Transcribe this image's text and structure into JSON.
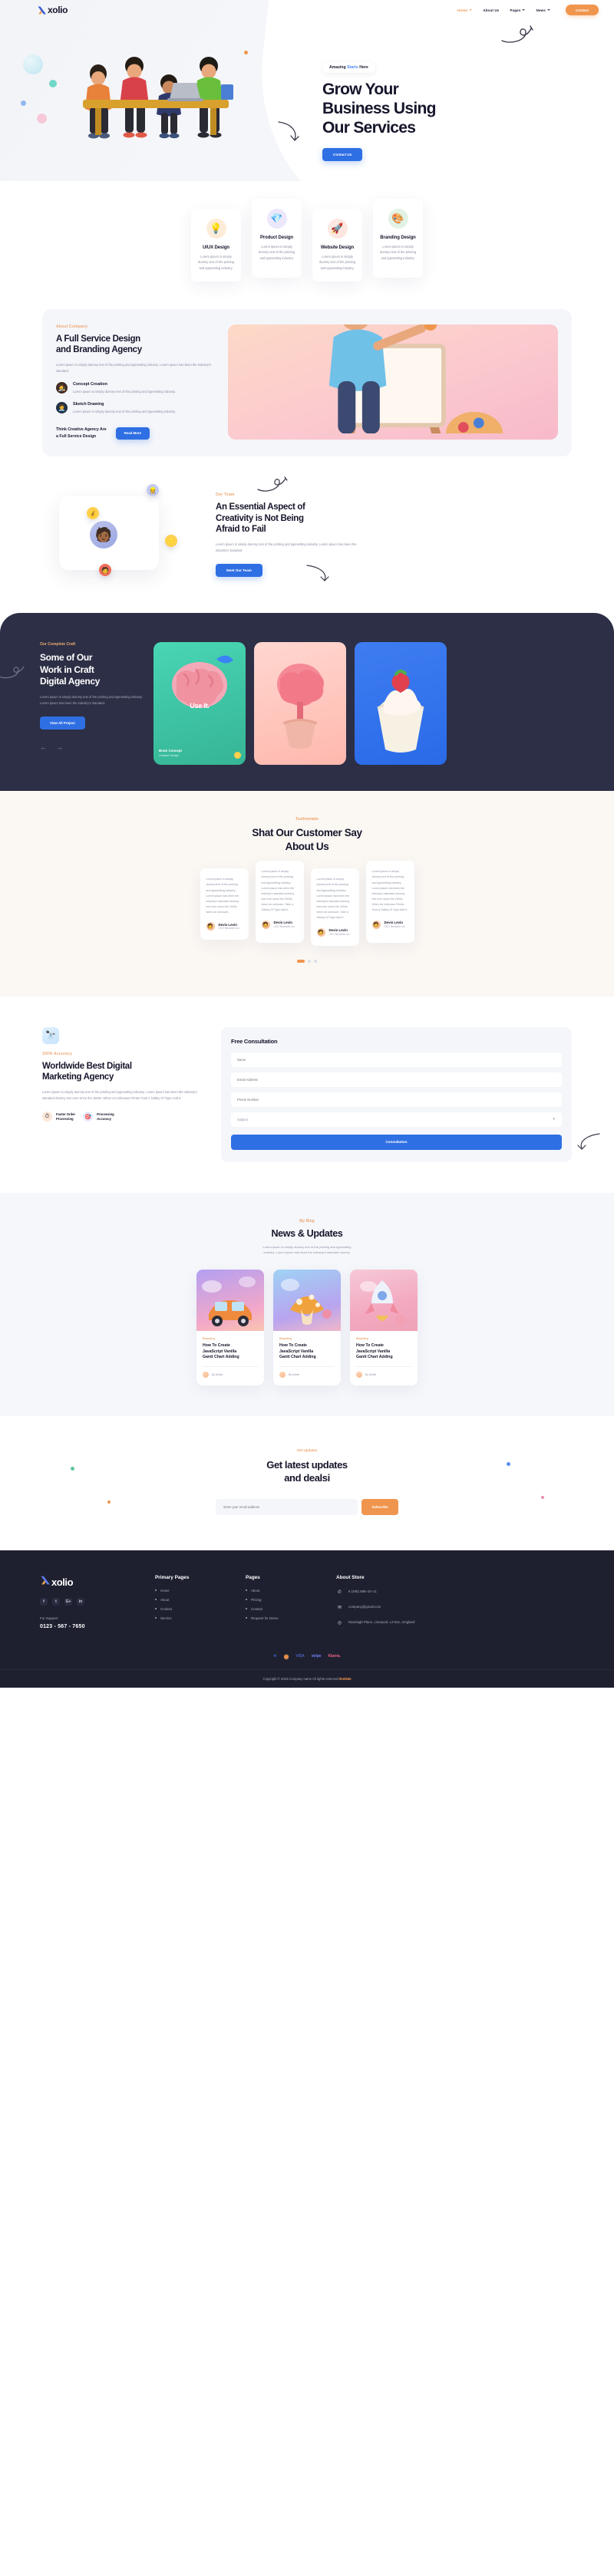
{
  "brand": {
    "name": "xolio",
    "logo_icon": "x-logo-icon"
  },
  "nav": {
    "items": [
      {
        "label": "Home",
        "caret": true,
        "active": true
      },
      {
        "label": "About Us",
        "caret": false,
        "active": false
      },
      {
        "label": "Pages",
        "caret": true,
        "active": false
      },
      {
        "label": "News",
        "caret": true,
        "active": false
      }
    ],
    "cta": "Contact"
  },
  "hero": {
    "badge_pre": "Amazing ",
    "badge_hl": "Starts",
    "badge_post": " Here",
    "title_line1": "Grow Your",
    "title_line2": "Business Using",
    "title_line3": "Our Services",
    "cta": "Contact Us"
  },
  "services": [
    {
      "title": "UIUX Design",
      "desc": "Lorem ipsum is simply dummy text of the printing and typesetting industry.",
      "icon": "lightbulb-icon",
      "icon_glyph": "💡",
      "bg": "#fdecd9"
    },
    {
      "title": "Product Design",
      "desc": "Lorem ipsum is simply dummy text of the printing and typesetting industry.",
      "icon": "gem-icon",
      "icon_glyph": "💎",
      "bg": "#ece7fb"
    },
    {
      "title": "Website Design",
      "desc": "Lorem ipsum is simply dummy text of the printing and typesetting industry.",
      "icon": "rocket-icon",
      "icon_glyph": "🚀",
      "bg": "#fde7e0"
    },
    {
      "title": "Branding Design",
      "desc": "Lorem ipsum is simply dummy text of the printing and typesetting industry.",
      "icon": "palette-icon",
      "icon_glyph": "🎨",
      "bg": "#e2f3e6"
    }
  ],
  "about": {
    "eyebrow": "About Company",
    "title_line1": "A Full Service Design",
    "title_line2": "and Branding Agency",
    "paragraph": "Lorem ipsum is simply dummy text of the printing and typesetting industry. Lorem ipsum has been the industry's standard.",
    "features": [
      {
        "title": "Concept Creation",
        "desc": "Lorem ipsum is simply dummy text of the printing and typesetting industry.",
        "icon": "concept-avatar-icon",
        "glyph": "🧑‍🎨",
        "bg": "#3f2a22"
      },
      {
        "title": "Sketch Drawing",
        "desc": "Lorem ipsum is simply dummy text of the printing and typesetting industry.",
        "icon": "sketch-avatar-icon",
        "glyph": "🧑‍💼",
        "bg": "#1f3145"
      }
    ],
    "cta_text_line1": "Think Creative Agency Are",
    "cta_text_line2": "a Full Service Design",
    "cta_button": "Read More",
    "illustration": "artist-easel-illustration"
  },
  "team": {
    "eyebrow": "Our Team",
    "title_line1": "An Essential Aspect of",
    "title_line2": "Creativity is Not Being",
    "title_line3": "Afraid to Fail",
    "paragraph": "Lorem ipsum is simply dummy text of the printing and typesetting industry. Lorem ipsum has been the industry's standard.",
    "cta": "Meet Our Team",
    "avatar_icon": "team-member-avatar",
    "badges": [
      {
        "icon": "helmet-avatar-icon",
        "glyph": "👷",
        "bg": "#c5cbee"
      },
      {
        "icon": "coin-icon",
        "glyph": "🟡",
        "bg": "#ffd04b"
      },
      {
        "icon": "star-icon",
        "glyph": "⭐",
        "bg": "#ffd04b"
      },
      {
        "icon": "person-icon",
        "glyph": "🧑",
        "bg": "#f26d5b"
      }
    ]
  },
  "portfolio": {
    "eyebrow": "Our Complete Craft",
    "title_line1": "Some of Our",
    "title_line2": "Work in Craft",
    "title_line3": "Digital Agency",
    "paragraph": "Lorem ipsum is simply dummy text of the printing and typesetting industry. Lorem ipsum has been the industry's standard.",
    "cta": "View All Project",
    "prev_icon": "arrow-left-icon",
    "next_icon": "arrow-right-icon",
    "cards": [
      {
        "overlay": "Use It.",
        "title": "Brain Concept",
        "subtitle": "Creative Design",
        "art": "brain-3d-illustration"
      },
      {
        "overlay": "",
        "title": "",
        "subtitle": "",
        "art": "coral-plant-3d-illustration"
      },
      {
        "overlay": "",
        "title": "",
        "subtitle": "",
        "art": "strawberry-cupcake-3d-illustration"
      }
    ]
  },
  "testimonials": {
    "eyebrow": "Testimonials",
    "title_line1": "Shat Our Customer Say",
    "title_line2": "About Us",
    "items": [
      {
        "quote": "Lorem ipsum is simply dummy text of the printing and typesetting industry. Lorem ipsum has been the industry's standard dummy text ever since the 1500s, when an unknown.",
        "name": "Devis Levin",
        "role": "CEO Newtoob Inc.",
        "avatar": "testimonial-avatar"
      },
      {
        "quote": "Lorem ipsum is simply dummy text of the printing and typesetting industry. Lorem ipsum has been the industry's standard dummy text ever since the 1500s, when an unknown. Take a Galaxy Of Type Add It.",
        "name": "Devis Levin",
        "role": "CEO Newtoob Inc.",
        "avatar": "testimonial-avatar"
      },
      {
        "quote": "Lorem ipsum is simply dummy text of the printing and typesetting industry. Lorem ipsum has been the industry's standard dummy text ever since the 1500s, when an unknown. Take a Galaxy Of Type Add It.",
        "name": "Devis Levin",
        "role": "CEO Newtoob Inc.",
        "avatar": "testimonial-avatar"
      },
      {
        "quote": "Lorem ipsum is simply dummy text of the printing and typesetting industry. Lorem ipsum has been the industry's standard dummy text ever since the 1500s. When An Unknown Printer Took A Galley Of Type Add It.",
        "name": "Devis Levin",
        "role": "CEO Newtoob Inc.",
        "avatar": "testimonial-avatar"
      }
    ],
    "pagination": {
      "pages": 3,
      "active": 1
    }
  },
  "consultation": {
    "eyebrow": "100% Accuracy",
    "title_line1": "Worldwide Best Digital",
    "title_line2": "Marketing Agency",
    "paragraph": "Lorem ipsum is simply dummy text of the printing and typesetting industry. Lorem ipsum has been the industry's standard dummy text ever since the 1500s. When An Unknown Printer Took A Galley Of Type Add It.",
    "badge_icon": "telescope-icon",
    "badge_glyph": "🔭",
    "pills": [
      {
        "title_line1": "Faster Order",
        "title_line2": "Processing",
        "icon": "clock-icon",
        "glyph": "⏱",
        "bg": "#fde7d8"
      },
      {
        "title_line1": "Processing",
        "title_line2": "Accuracy",
        "icon": "target-icon",
        "glyph": "🎯",
        "bg": "#e4ecfd"
      }
    ],
    "form": {
      "title": "Free Consultation",
      "fields": [
        {
          "name": "name-field",
          "placeholder": "Name",
          "value": ""
        },
        {
          "name": "email-field",
          "placeholder": "Email Address",
          "value": ""
        },
        {
          "name": "phone-field",
          "placeholder": "Phone Number",
          "value": ""
        }
      ],
      "select": {
        "name": "subject-select",
        "value": "Subject",
        "caret_icon": "chevron-down-icon"
      },
      "submit": "Consultation"
    }
  },
  "blog": {
    "eyebrow": "My Blog",
    "title": "News & Updates",
    "subtitle_line1": "Lorem ipsum is simply dummy text of the printing and typesetting",
    "subtitle_line2": "industry. Lorem ipsum has been the industry's standard dummy.",
    "posts": [
      {
        "category": "Branding",
        "title_line1": "How To Create",
        "title_line2": "JavaScript Vanilla",
        "title_line3": "Gantt Chart Adding",
        "author": "By Admin",
        "art": "car-3d-illustration"
      },
      {
        "category": "Branding",
        "title_line1": "How To Create",
        "title_line2": "JavaScript Vanilla",
        "title_line3": "Gantt Chart Adding",
        "author": "By Admin",
        "art": "mushroom-3d-illustration"
      },
      {
        "category": "Branding",
        "title_line1": "How To Create",
        "title_line2": "JavaScript Vanilla",
        "title_line3": "Gantt Chart Adding",
        "author": "By Admin",
        "art": "rocket-3d-illustration"
      }
    ]
  },
  "newsletter": {
    "eyebrow": "Get Updates",
    "title_line1": "Get latest updates",
    "title_line2": "and dealsi",
    "input_placeholder": "Enter your email address",
    "input_value": "",
    "button": "Subscribe"
  },
  "footer": {
    "brand": "xolio",
    "social": [
      {
        "label": "f",
        "name": "facebook-icon"
      },
      {
        "label": "t",
        "name": "twitter-icon"
      },
      {
        "label": "G+",
        "name": "google-plus-icon"
      },
      {
        "label": "in",
        "name": "linkedin-icon"
      }
    ],
    "support_label": "For Support",
    "support_phone": "0123 - 567 - 7650",
    "columns": [
      {
        "heading": "Primary Pages",
        "links": [
          "Home",
          "About",
          "Contact",
          "Service"
        ]
      },
      {
        "heading": "Pages",
        "links": [
          "About",
          "Pricing",
          "Contact",
          "Request for Demo"
        ]
      }
    ],
    "about": {
      "heading": "About Store",
      "items": [
        {
          "icon": "phone-icon",
          "glyph": "📞",
          "text": "8 (495) 989–20–11"
        },
        {
          "icon": "mail-icon",
          "glyph": "✉",
          "text": "company@gmail.com"
        },
        {
          "icon": "location-icon",
          "glyph": "◎",
          "text": "Ranelagh Place, Liverpool, L3 5UL, England"
        }
      ]
    },
    "payments": [
      {
        "label": "✈",
        "name": "paypal-icon",
        "color": "#3b6ee0"
      },
      {
        "label": "◉",
        "name": "mastercard-icon",
        "color": "#f0954d"
      },
      {
        "label": "VISA",
        "name": "visa-icon",
        "color": "#4a5fb8"
      },
      {
        "label": "stripe",
        "name": "stripe-icon",
        "color": "#5a6ce0"
      },
      {
        "label": "Klarna.",
        "name": "klarna-icon",
        "color": "#e0607e"
      }
    ],
    "copyright_text": "Copyright © 2023.Company name All rights reserved.",
    "copyright_link": "html666"
  },
  "colors": {
    "accent_orange": "#f0954d",
    "accent_blue": "#2f6fe4",
    "dark": "#2c2f45",
    "footer_dark": "#1e2030",
    "muted": "#8b8fa3"
  }
}
